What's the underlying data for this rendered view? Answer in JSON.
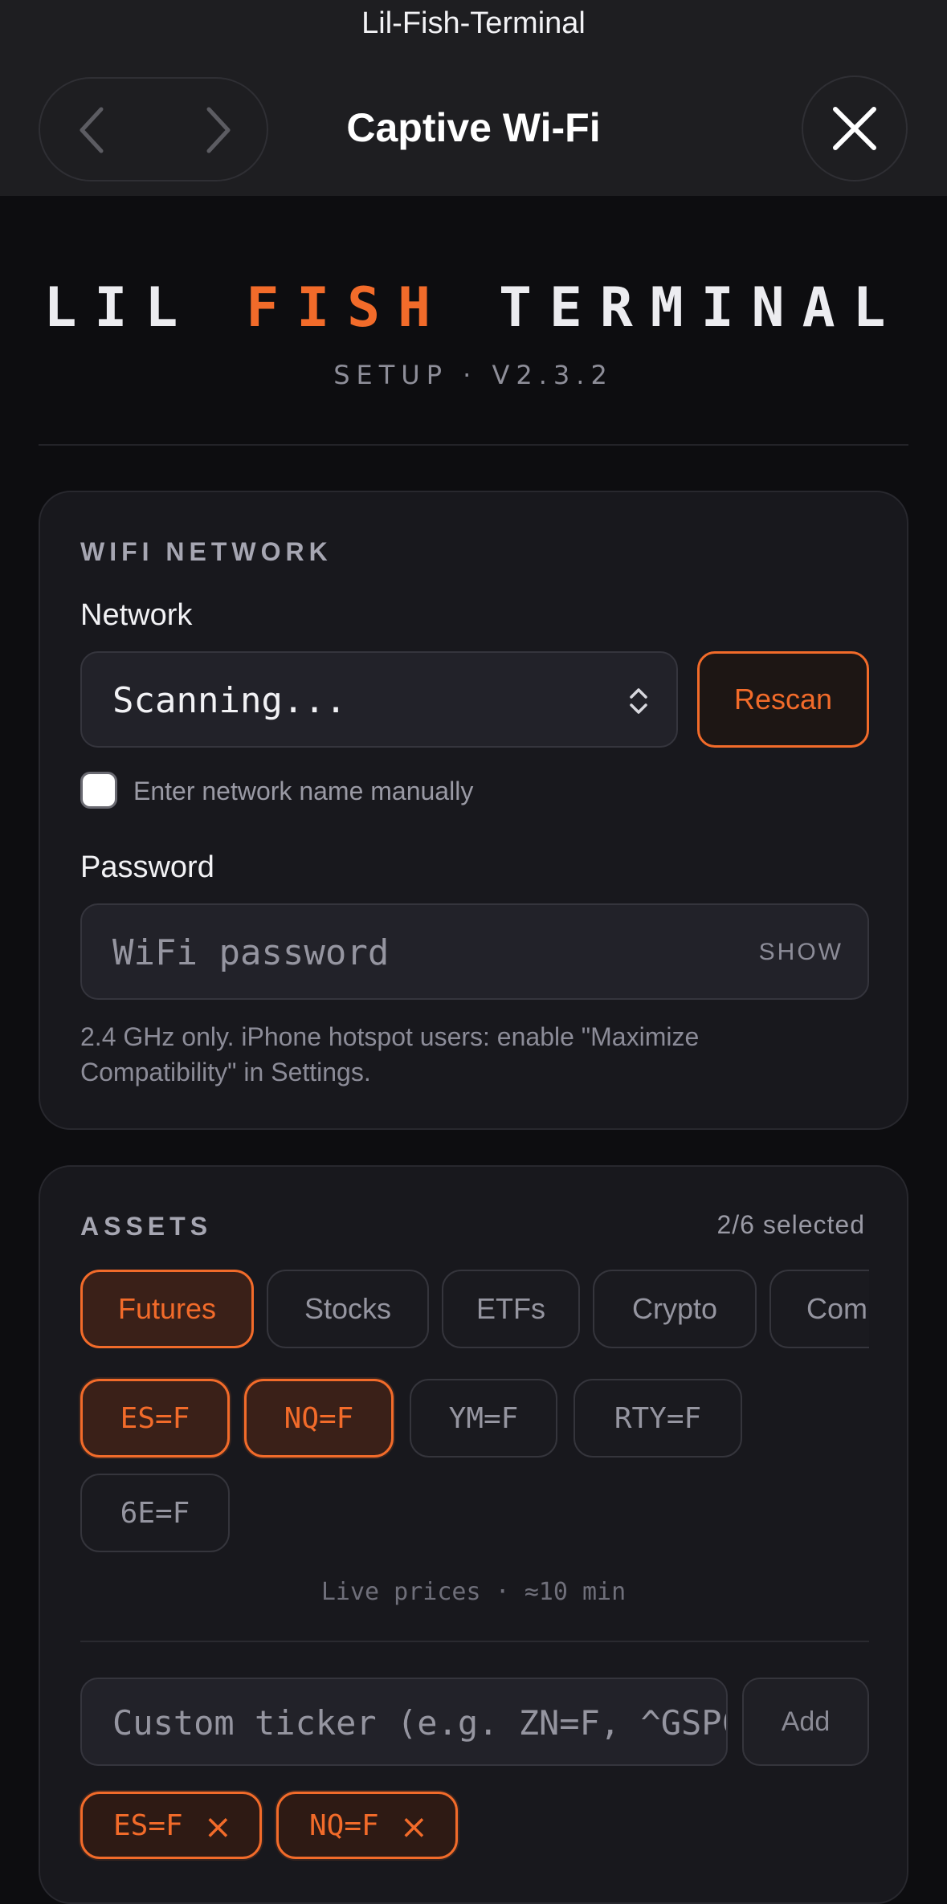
{
  "browser": {
    "app_name": "Lil-Fish-Terminal",
    "title": "Captive Wi-Fi"
  },
  "header": {
    "brand_part1": "LIL",
    "brand_part2": "FISH",
    "brand_part3": "TERMINAL",
    "subtitle": "SETUP · V2.3.2",
    "accent_color": "#f26b2a"
  },
  "wifi": {
    "section_label": "WIFI NETWORK",
    "network_label": "Network",
    "network_value": "Scanning...",
    "rescan_label": "Rescan",
    "manual_label": "Enter network name manually",
    "password_label": "Password",
    "password_placeholder": "WiFi password",
    "show_label": "SHOW",
    "hint": "2.4 GHz only. iPhone hotspot users: enable \"Maximize Compatibility\" in Settings."
  },
  "assets": {
    "section_label": "ASSETS",
    "selected_count": "2/6 selected",
    "categories": [
      {
        "label": "Futures",
        "active": true
      },
      {
        "label": "Stocks",
        "active": false
      },
      {
        "label": "ETFs",
        "active": false
      },
      {
        "label": "Crypto",
        "active": false
      },
      {
        "label": "Comm",
        "active": false
      }
    ],
    "tickers": [
      {
        "label": "ES=F",
        "active": true
      },
      {
        "label": "NQ=F",
        "active": true
      },
      {
        "label": "YM=F",
        "active": false
      },
      {
        "label": "RTY=F",
        "active": false
      },
      {
        "label": "6E=F",
        "active": false
      }
    ],
    "live_note": "Live prices · ≈10 min",
    "custom_placeholder": "Custom ticker (e.g. ZN=F, ^GSPC)",
    "add_label": "Add",
    "selected": [
      {
        "label": "ES=F",
        "remove": "×"
      },
      {
        "label": "NQ=F",
        "remove": "×"
      }
    ]
  }
}
